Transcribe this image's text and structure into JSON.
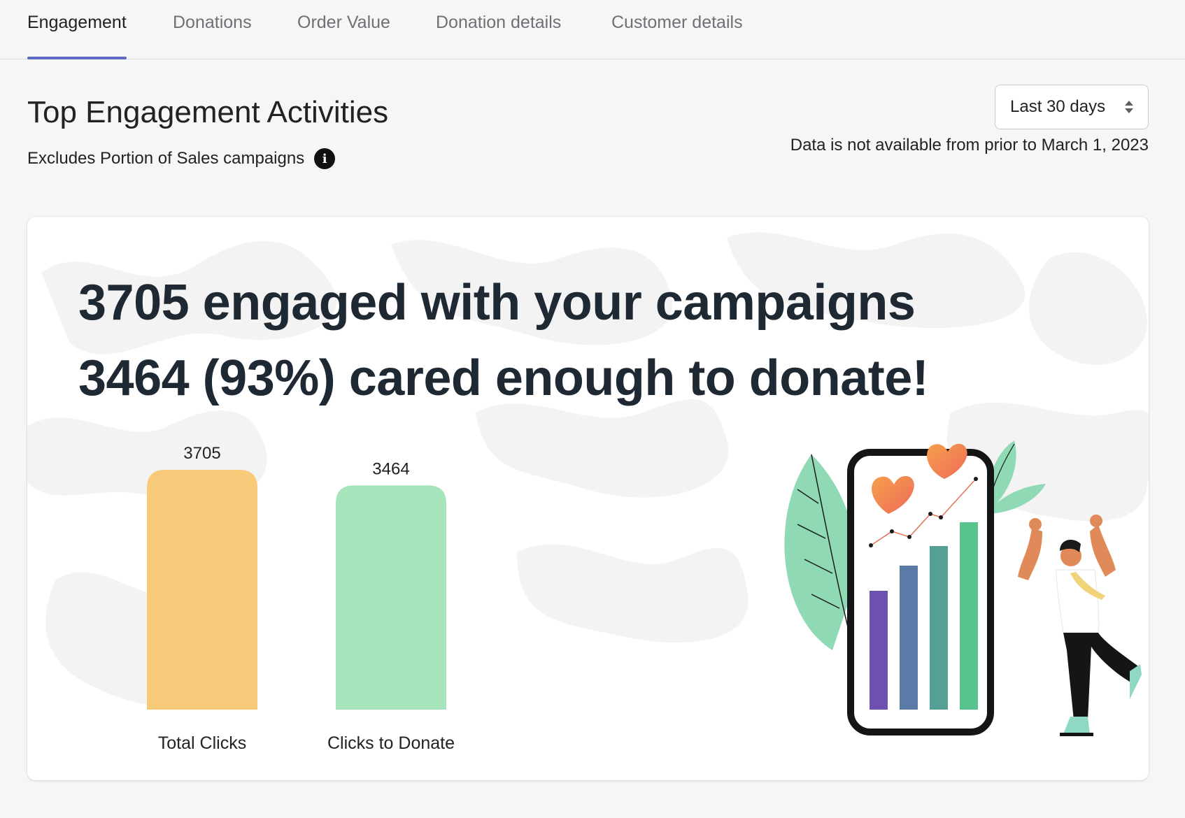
{
  "tabs": [
    {
      "label": "Engagement",
      "active": true
    },
    {
      "label": "Donations",
      "active": false
    },
    {
      "label": "Order Value",
      "active": false
    },
    {
      "label": "Donation details",
      "active": false
    },
    {
      "label": "Customer details",
      "active": false
    }
  ],
  "page": {
    "title": "Top Engagement Activities",
    "subtitle": "Excludes Portion of Sales campaigns",
    "info_icon": "info-icon",
    "range_select": "Last 30 days",
    "data_note": "Data is not available from prior to March 1, 2023"
  },
  "card": {
    "headline_1": "3705 engaged with your campaigns",
    "headline_2": "3464 (93%) cared enough to donate!"
  },
  "colors": {
    "accent": "#5c6ac4",
    "bar_total": "#f7ca79",
    "bar_donate": "#a6e4bb"
  },
  "chart_data": {
    "type": "bar",
    "categories": [
      "Total Clicks",
      "Clicks to Donate"
    ],
    "values": [
      3705,
      3464
    ],
    "data_labels": [
      "3705",
      "3464"
    ],
    "ylim": [
      0,
      3705
    ],
    "grid": false,
    "colors": [
      "#f7ca79",
      "#a6e4bb"
    ]
  }
}
